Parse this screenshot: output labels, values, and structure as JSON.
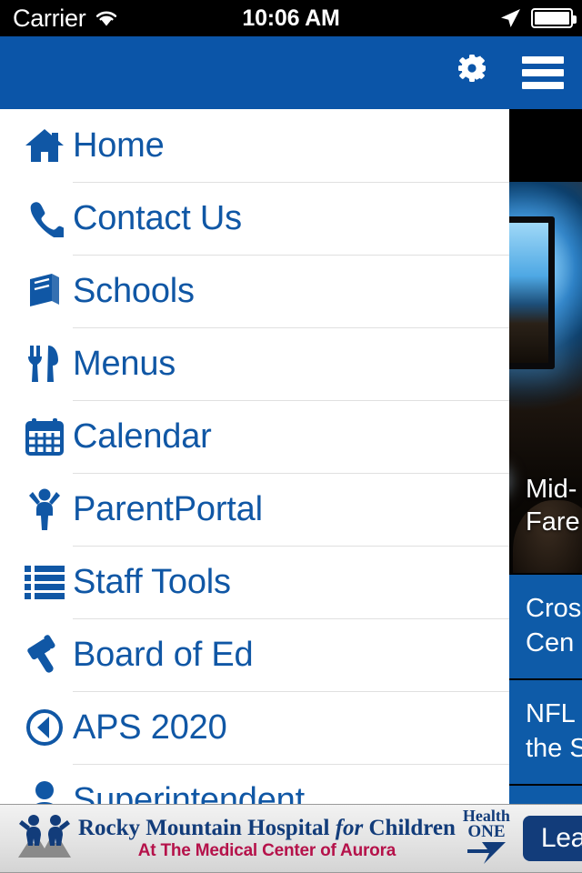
{
  "status_bar": {
    "carrier": "Carrier",
    "wifi_icon": "wifi-icon",
    "time": "10:06 AM",
    "location_icon": "location-arrow-icon",
    "battery_icon": "battery-full-icon"
  },
  "nav_bar": {
    "background_color": "#0B55A8",
    "settings_icon": "gear-icon",
    "menu_icon": "hamburger-menu-icon"
  },
  "drawer": {
    "accent_color": "#1057A5",
    "items": [
      {
        "label": "Home",
        "icon": "home-icon"
      },
      {
        "label": "Contact Us",
        "icon": "phone-icon"
      },
      {
        "label": "Schools",
        "icon": "book-icon"
      },
      {
        "label": "Menus",
        "icon": "fork-knife-icon"
      },
      {
        "label": "Calendar",
        "icon": "calendar-icon"
      },
      {
        "label": "ParentPortal",
        "icon": "child-icon"
      },
      {
        "label": "Staff Tools",
        "icon": "list-icon"
      },
      {
        "label": "Board of Ed",
        "icon": "gavel-icon"
      },
      {
        "label": "APS 2020",
        "icon": "compass-icon"
      },
      {
        "label": "Superintendent",
        "icon": "person-icon"
      }
    ]
  },
  "content_panel": {
    "card_color": "#0E5BA8",
    "cards": [
      {
        "title_line1": "Mid-",
        "title_line2": "Fare",
        "type": "photo"
      },
      {
        "title_line1": "Cros",
        "title_line2": "Cen",
        "type": "blue"
      },
      {
        "title_line1": "NFL",
        "title_line2": "the S",
        "type": "blue"
      }
    ]
  },
  "ad_banner": {
    "logo_icon": "rocky-mountain-children-logo",
    "title_part1": "Rocky Mountain Hospital ",
    "title_italic": "for",
    "title_part2": " Children",
    "subtitle": "At The Medical Center of Aurora",
    "sponsor_line1": "Health",
    "sponsor_line2": "ONE",
    "sponsor_icon": "healthone-bolt-icon",
    "cta_label": "Learn More"
  }
}
